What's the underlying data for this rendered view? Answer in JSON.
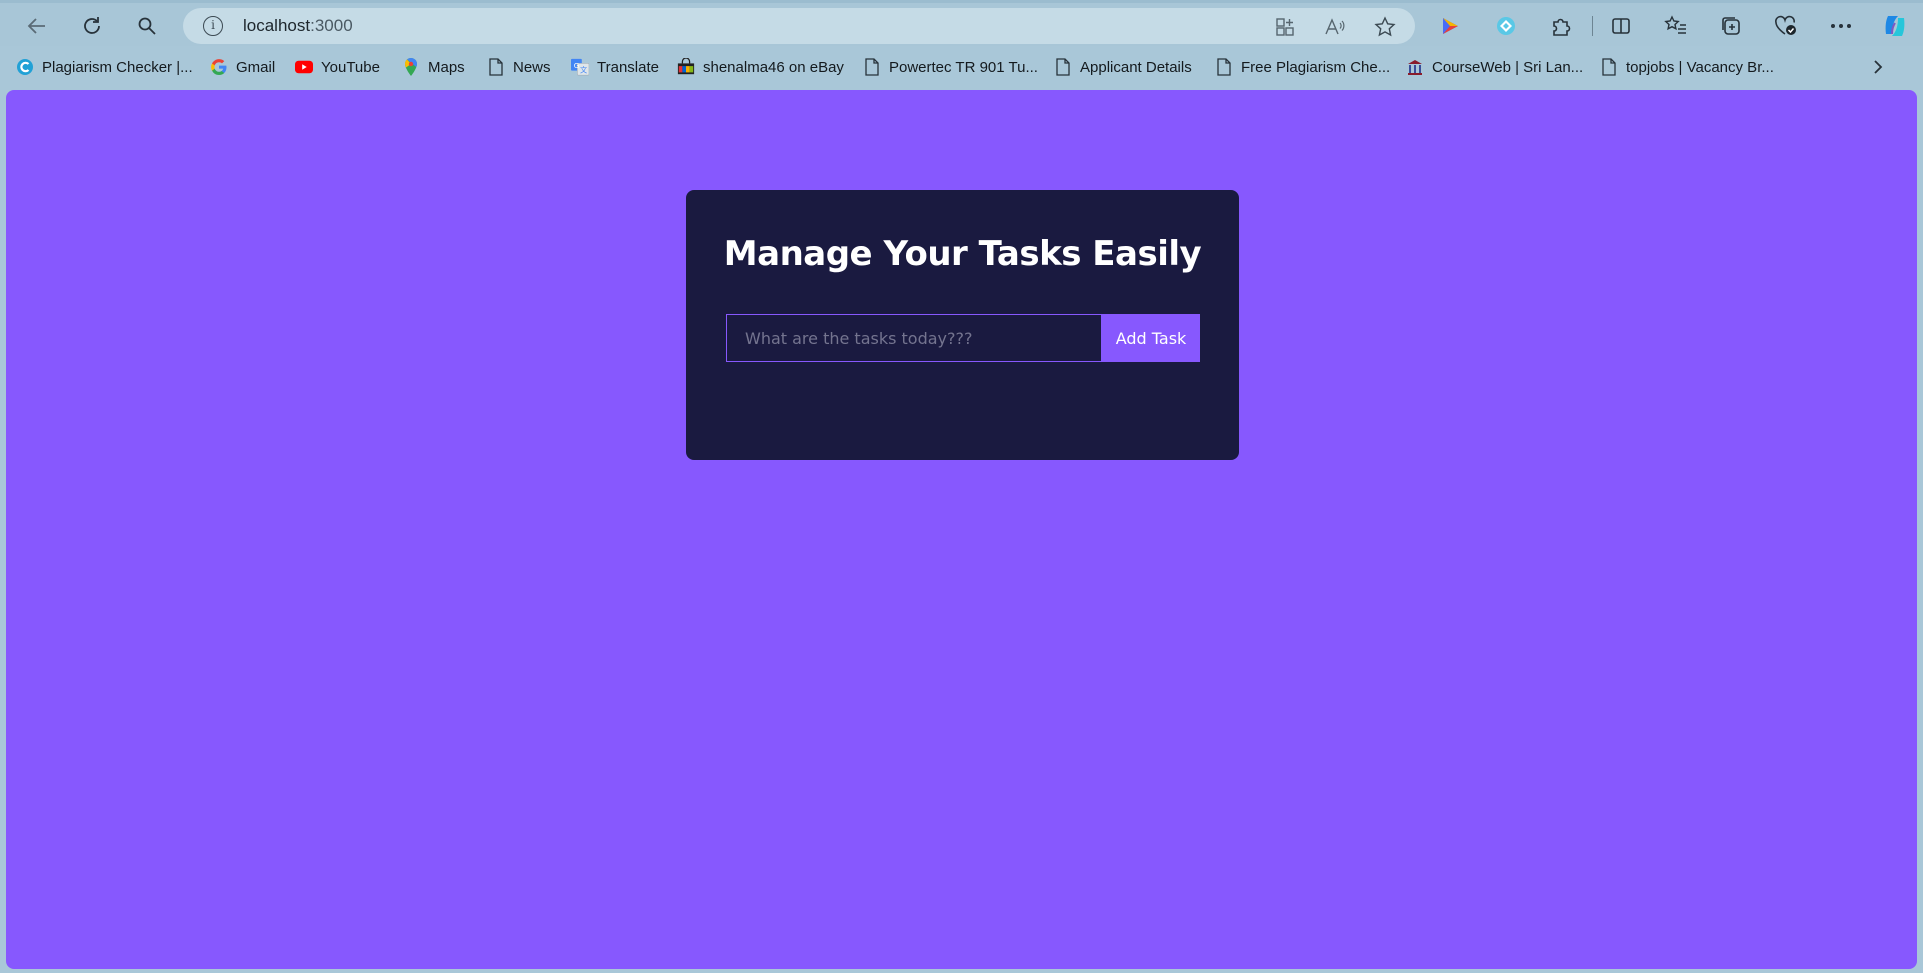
{
  "browser": {
    "address_host": "localhost",
    "address_port": ":3000",
    "icons": {
      "back": "back-arrow-icon",
      "refresh": "refresh-icon",
      "search": "search-icon",
      "site_info": "info-icon",
      "app_install": "app-install-icon",
      "read_aloud": "read-aloud-icon",
      "favorite": "star-icon",
      "profile": "play-icon",
      "extension1": "diamond-extension-icon",
      "extensions": "puzzle-icon",
      "split_screen": "split-screen-icon",
      "favorites": "favorites-list-icon",
      "collections": "collections-icon",
      "performance": "heart-check-icon",
      "more": "more-dots-icon",
      "copilot": "copilot-icon"
    }
  },
  "bookmarks": [
    {
      "label": "Plagiarism Checker |...",
      "icon": "c-logo-icon"
    },
    {
      "label": "Gmail",
      "icon": "google-icon"
    },
    {
      "label": "YouTube",
      "icon": "youtube-icon"
    },
    {
      "label": "Maps",
      "icon": "maps-pin-icon"
    },
    {
      "label": "News",
      "icon": "page-icon"
    },
    {
      "label": "Translate",
      "icon": "translate-icon"
    },
    {
      "label": "shenalma46 on eBay",
      "icon": "ebay-bag-icon"
    },
    {
      "label": "Powertec TR 901 Tu...",
      "icon": "page-icon"
    },
    {
      "label": "Applicant Details",
      "icon": "page-icon"
    },
    {
      "label": "Free Plagiarism Che...",
      "icon": "page-icon"
    },
    {
      "label": "CourseWeb | Sri Lan...",
      "icon": "courseweb-icon"
    },
    {
      "label": "topjobs | Vacancy Br...",
      "icon": "page-icon"
    }
  ],
  "app": {
    "title": "Manage Your Tasks Easily",
    "input_placeholder": "What are the tasks today???",
    "input_value": "",
    "add_button": "Add Task"
  },
  "colors": {
    "background": "#8758fe",
    "card": "#1a1a40",
    "button": "#8758fe",
    "text": "#ffffff"
  }
}
